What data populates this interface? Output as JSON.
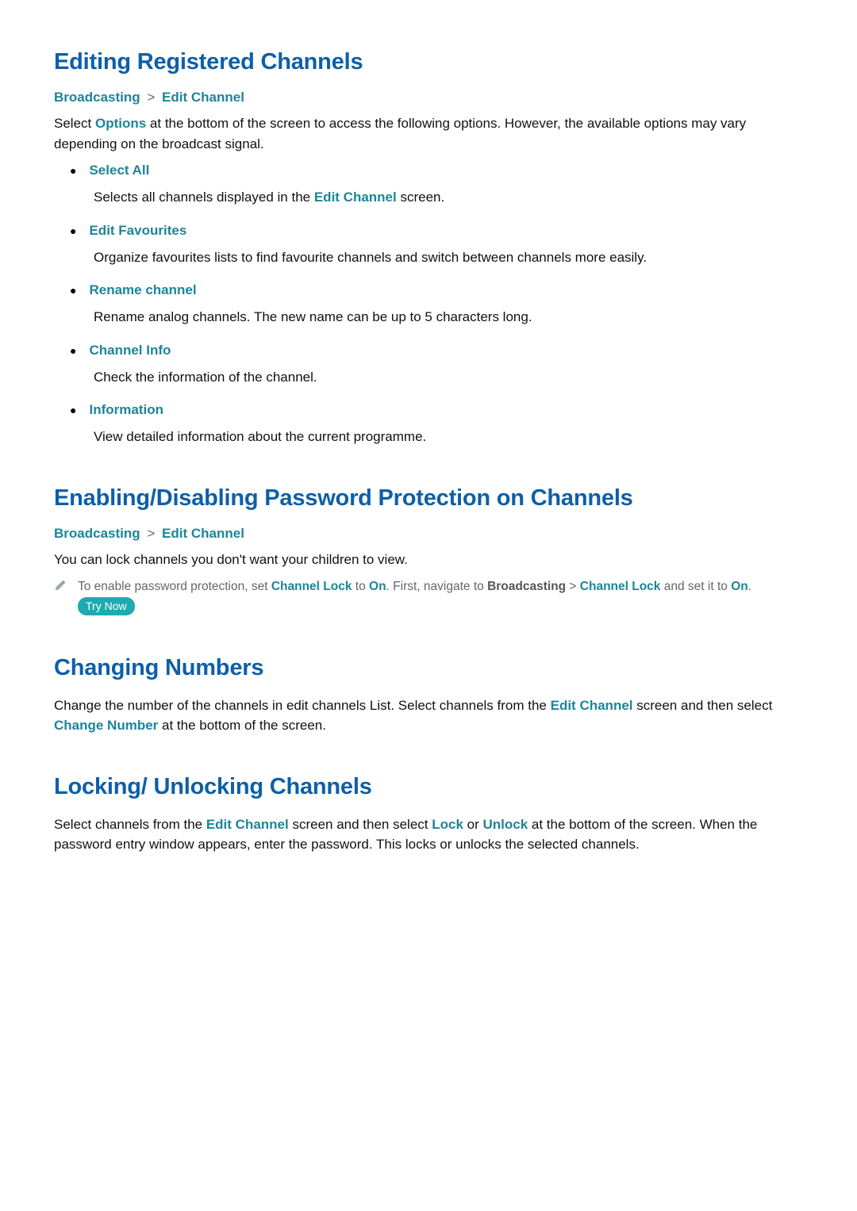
{
  "section1": {
    "title": "Editing Registered Channels",
    "breadcrumb": {
      "a": "Broadcasting",
      "b": "Edit Channel"
    },
    "intro_pre": "Select ",
    "intro_kw": "Options",
    "intro_post": " at the bottom of the screen to access the following options. However, the available options may vary depending on the broadcast signal.",
    "options": [
      {
        "title": "Select All",
        "desc_pre": "Selects all channels displayed in the ",
        "desc_kw": "Edit Channel",
        "desc_post": " screen."
      },
      {
        "title": "Edit Favourites",
        "desc_pre": "Organize favourites lists to find favourite channels and switch between channels more easily.",
        "desc_kw": "",
        "desc_post": ""
      },
      {
        "title": "Rename channel",
        "desc_pre": "Rename analog channels. The new name can be up to 5 characters long.",
        "desc_kw": "",
        "desc_post": ""
      },
      {
        "title": "Channel Info",
        "desc_pre": "Check the information of the channel.",
        "desc_kw": "",
        "desc_post": ""
      },
      {
        "title": "Information",
        "desc_pre": "View detailed information about the current programme.",
        "desc_kw": "",
        "desc_post": ""
      }
    ]
  },
  "section2": {
    "title": "Enabling/Disabling Password Protection on Channels",
    "breadcrumb": {
      "a": "Broadcasting",
      "b": "Edit Channel"
    },
    "intro": "You can lock channels you don't want your children to view.",
    "note": {
      "t1": "To enable password protection, set ",
      "k1": "Channel Lock",
      "t2": " to ",
      "k2": "On",
      "t3": ". First, navigate to ",
      "k3": "Broadcasting",
      "t4": " > ",
      "k4": "Channel Lock",
      "t5": " and set it to ",
      "k5": "On",
      "t6": ". ",
      "try_now": "Try Now"
    }
  },
  "section3": {
    "title": "Changing Numbers",
    "p": {
      "t1": "Change the number of the channels in edit channels List. Select channels from the ",
      "k1": "Edit Channel",
      "t2": " screen and then select ",
      "k2": "Change Number",
      "t3": " at the bottom of the screen."
    }
  },
  "section4": {
    "title": "Locking/ Unlocking Channels",
    "p": {
      "t1": "Select channels from the ",
      "k1": "Edit Channel",
      "t2": " screen and then select ",
      "k2": "Lock",
      "t3": " or ",
      "k3": "Unlock",
      "t4": " at the bottom of the screen. When the password entry window appears, enter the password. This locks or unlocks the selected channels."
    }
  }
}
